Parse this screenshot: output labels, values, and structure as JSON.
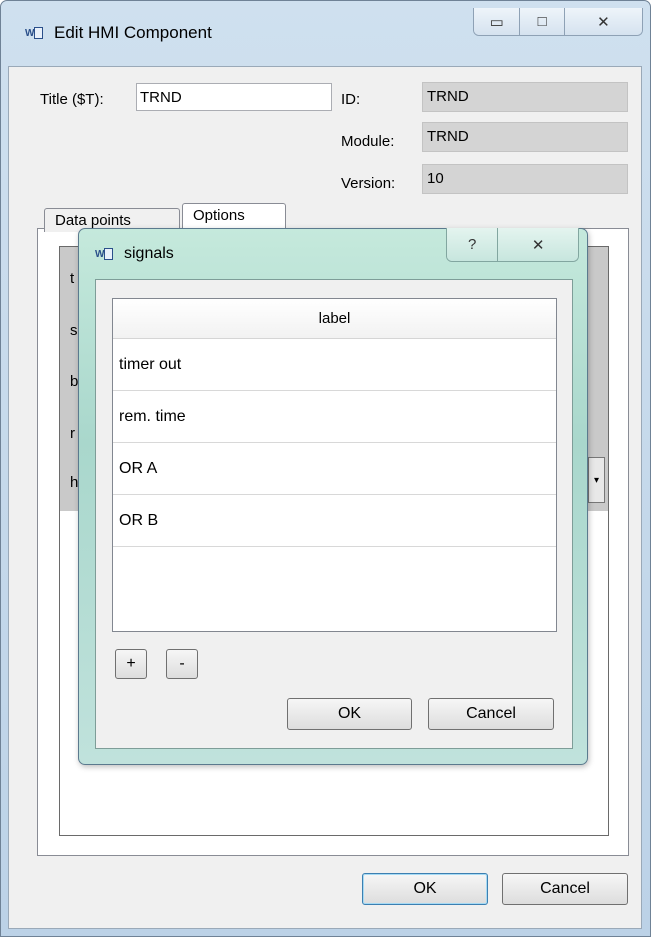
{
  "window": {
    "title": "Edit HMI Component",
    "caption": {
      "minimize": "▭",
      "maximize": "□",
      "close": "✕"
    }
  },
  "form": {
    "title_label": "Title ($T):",
    "title_value": "TRND",
    "id_label": "ID:",
    "id_value": "TRND",
    "module_label": "Module:",
    "module_value": "TRND",
    "version_label": "Version:",
    "version_value": "10"
  },
  "tabs": [
    {
      "label": "Data points",
      "active": false
    },
    {
      "label": "Options",
      "active": true
    }
  ],
  "background_rows": [
    "t",
    "s",
    "b",
    "r",
    "h"
  ],
  "buttons": {
    "ok": "OK",
    "cancel": "Cancel"
  },
  "signals_dialog": {
    "title": "signals",
    "caption": {
      "help": "?",
      "close": "✕"
    },
    "column_header": "label",
    "rows": [
      "timer out",
      "rem. time",
      "OR A",
      "OR B"
    ],
    "add_label": "+",
    "remove_label": "-",
    "ok": "OK",
    "cancel": "Cancel"
  },
  "colors": {
    "dialog_frame": "#b8e0d6",
    "main_frame": "#c4d8eb",
    "default_button_border": "#3c7fb1"
  }
}
